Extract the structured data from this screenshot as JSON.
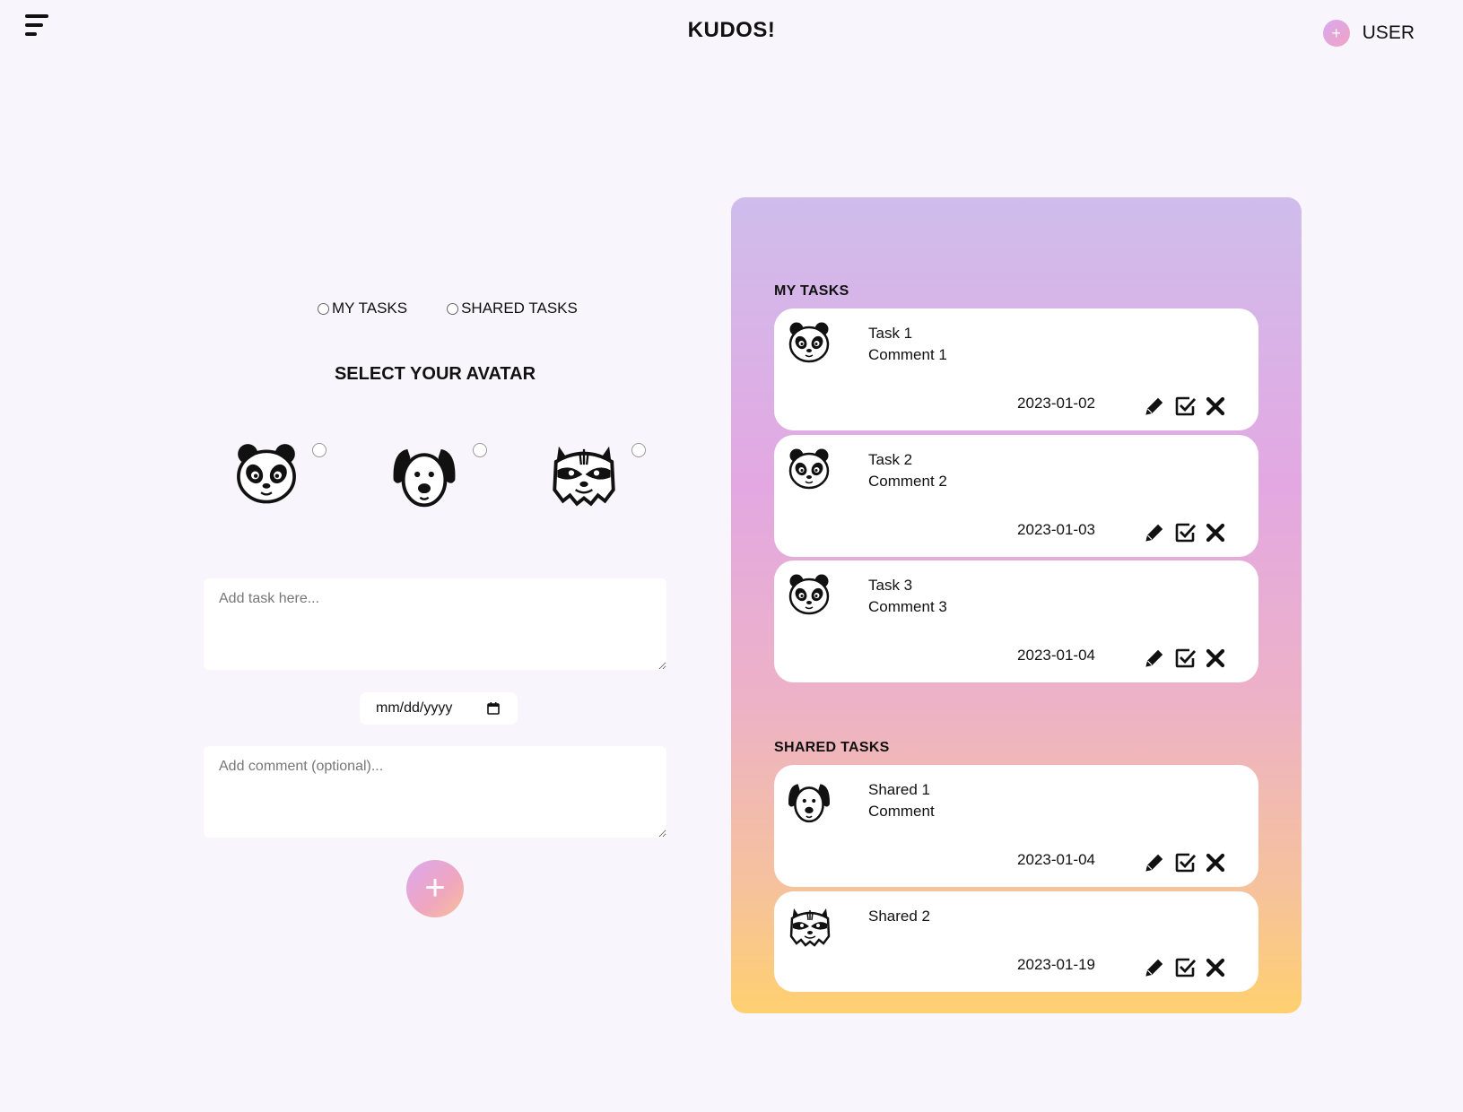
{
  "header": {
    "title": "KUDOS!",
    "user_label": "USER",
    "user_avatar_symbol": "+"
  },
  "view_toggle": {
    "my_tasks_label": "MY TASKS",
    "shared_tasks_label": "SHARED TASKS"
  },
  "avatar_select": {
    "heading": "SELECT YOUR AVATAR",
    "options": [
      {
        "icon": "panda-icon"
      },
      {
        "icon": "dog-icon"
      },
      {
        "icon": "raccoon-icon"
      }
    ]
  },
  "form": {
    "task_placeholder": "Add task here...",
    "date_placeholder": "mm/dd/yyyy",
    "comment_placeholder": "Add comment (optional)...",
    "add_symbol": "+"
  },
  "panel": {
    "my_tasks_title": "MY TASKS",
    "shared_tasks_title": "SHARED TASKS",
    "my_tasks": [
      {
        "avatar": "panda-icon",
        "title": "Task 1",
        "comment": "Comment 1",
        "date": "2023-01-02"
      },
      {
        "avatar": "panda-icon",
        "title": "Task 2",
        "comment": "Comment 2",
        "date": "2023-01-03"
      },
      {
        "avatar": "panda-icon",
        "title": "Task 3",
        "comment": "Comment 3",
        "date": "2023-01-04"
      }
    ],
    "shared_tasks": [
      {
        "avatar": "dog-icon",
        "title": "Shared 1",
        "comment": "Comment",
        "date": "2023-01-04"
      },
      {
        "avatar": "raccoon-icon",
        "title": "Shared 2",
        "comment": "",
        "date": "2023-01-19"
      }
    ]
  },
  "colors": {
    "background": "#f9f5fc",
    "panel_top": "#cfbdec",
    "panel_middle": "#e3a8e2",
    "panel_bottom": "#ffd070",
    "accent": "#dca8f0"
  }
}
